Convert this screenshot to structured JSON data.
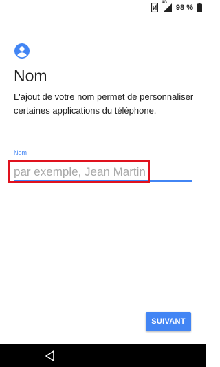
{
  "status_bar": {
    "network_type": "4G",
    "battery_percent": "98 %",
    "icons": [
      "nfc-icon",
      "signal-icon",
      "battery-icon"
    ]
  },
  "page": {
    "icon": "account-circle-icon",
    "title": "Nom",
    "description": "L'ajout de votre nom permet de personnaliser certaines applications du téléphone."
  },
  "name_field": {
    "label": "Nom",
    "value": "",
    "placeholder": "par exemple, Jean Martin"
  },
  "next_button": {
    "label": "SUIVANT"
  },
  "nav_bar": {
    "icons": [
      "back-icon"
    ]
  },
  "colors": {
    "accent": "#4285f4",
    "highlight": "#e0121e",
    "text": "#212121",
    "placeholder": "#a8a8a8",
    "nav_bar": "#000000"
  }
}
